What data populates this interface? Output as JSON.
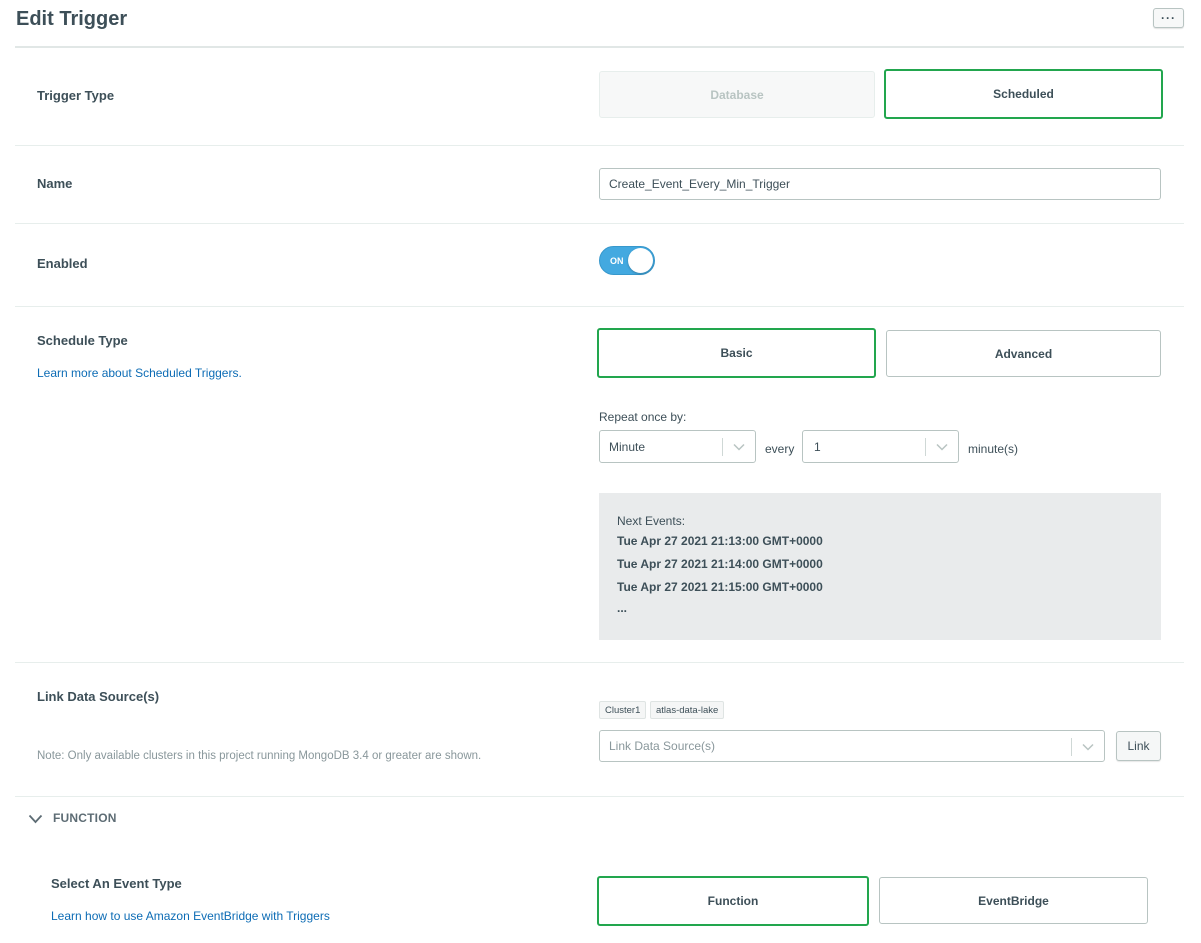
{
  "page": {
    "title": "Edit Trigger",
    "more_label": "···"
  },
  "trigger_type": {
    "label": "Trigger Type",
    "options": [
      {
        "label": "Database",
        "state": "disabled"
      },
      {
        "label": "Scheduled",
        "state": "selected"
      }
    ]
  },
  "name": {
    "label": "Name",
    "value": "Create_Event_Every_Min_Trigger"
  },
  "enabled": {
    "label": "Enabled",
    "toggle_text": "ON",
    "value": true
  },
  "schedule_type": {
    "label": "Schedule Type",
    "learn_more": "Learn more about Scheduled Triggers.",
    "options": [
      {
        "label": "Basic",
        "state": "selected"
      },
      {
        "label": "Advanced",
        "state": "default"
      }
    ],
    "repeat_label": "Repeat once by:",
    "unit_select": {
      "value": "Minute"
    },
    "every_label": "every",
    "interval_select": {
      "value": "1"
    },
    "interval_unit": "minute(s)",
    "next_events": {
      "label": "Next Events:",
      "items": [
        "Tue Apr 27 2021 21:13:00 GMT+0000",
        "Tue Apr 27 2021 21:14:00 GMT+0000",
        "Tue Apr 27 2021 21:15:00 GMT+0000"
      ],
      "ellipsis": "..."
    }
  },
  "link_data_source": {
    "label": "Link Data Source(s)",
    "note": "Note: Only available clusters in this project running MongoDB 3.4 or greater are shown.",
    "chips": [
      "Cluster1",
      "atlas-data-lake"
    ],
    "placeholder": "Link Data Source(s)",
    "link_button": "Link"
  },
  "function_section": {
    "title": "FUNCTION",
    "event_type_label": "Select An Event Type",
    "event_type_link": "Learn how to use Amazon EventBridge with Triggers",
    "options": [
      {
        "label": "Function",
        "state": "selected"
      },
      {
        "label": "EventBridge",
        "state": "default"
      }
    ]
  },
  "colors": {
    "selected_border": "#22a64e",
    "toggle_on": "#43a9e0",
    "link": "#0d6cb5",
    "text": "#3d4f58"
  }
}
